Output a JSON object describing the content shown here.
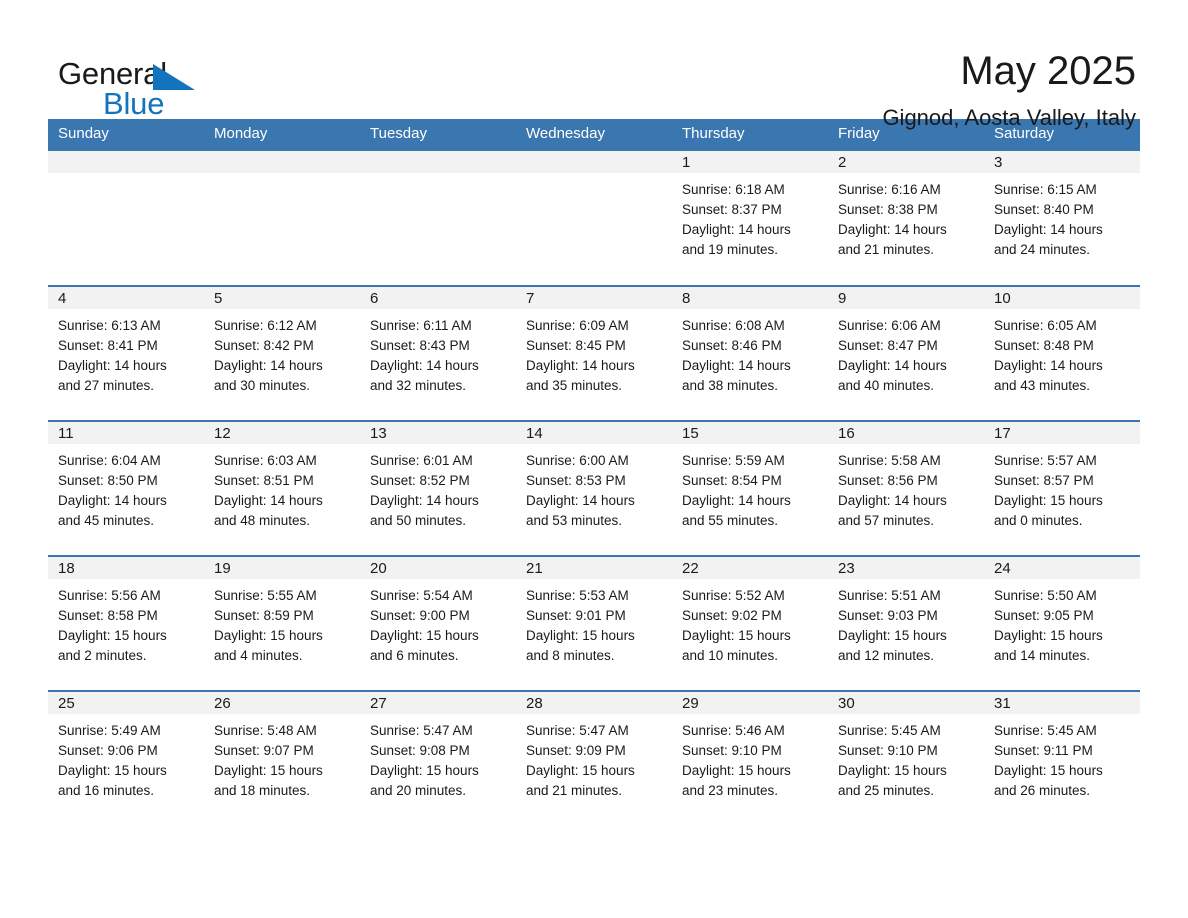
{
  "brand": {
    "name_part1": "General",
    "name_part2": "Blue",
    "accent_color": "#1274bc"
  },
  "header": {
    "title": "May 2025",
    "subtitle": "Gignod, Aosta Valley, Italy"
  },
  "theme": {
    "header_blue": "#3a76b0",
    "day_head_gray": "#f2f2f2",
    "text": "#1a1a1a"
  },
  "calendar": {
    "weekdays": [
      "Sunday",
      "Monday",
      "Tuesday",
      "Wednesday",
      "Thursday",
      "Friday",
      "Saturday"
    ],
    "labels": {
      "sunrise": "Sunrise:",
      "sunset": "Sunset:",
      "daylight": "Daylight:"
    },
    "weeks": [
      [
        {
          "day": "",
          "sunrise": "",
          "sunset": "",
          "daylight_line1": "",
          "daylight_line2": ""
        },
        {
          "day": "",
          "sunrise": "",
          "sunset": "",
          "daylight_line1": "",
          "daylight_line2": ""
        },
        {
          "day": "",
          "sunrise": "",
          "sunset": "",
          "daylight_line1": "",
          "daylight_line2": ""
        },
        {
          "day": "",
          "sunrise": "",
          "sunset": "",
          "daylight_line1": "",
          "daylight_line2": ""
        },
        {
          "day": "1",
          "sunrise": "Sunrise: 6:18 AM",
          "sunset": "Sunset: 8:37 PM",
          "daylight_line1": "Daylight: 14 hours",
          "daylight_line2": "and 19 minutes."
        },
        {
          "day": "2",
          "sunrise": "Sunrise: 6:16 AM",
          "sunset": "Sunset: 8:38 PM",
          "daylight_line1": "Daylight: 14 hours",
          "daylight_line2": "and 21 minutes."
        },
        {
          "day": "3",
          "sunrise": "Sunrise: 6:15 AM",
          "sunset": "Sunset: 8:40 PM",
          "daylight_line1": "Daylight: 14 hours",
          "daylight_line2": "and 24 minutes."
        }
      ],
      [
        {
          "day": "4",
          "sunrise": "Sunrise: 6:13 AM",
          "sunset": "Sunset: 8:41 PM",
          "daylight_line1": "Daylight: 14 hours",
          "daylight_line2": "and 27 minutes."
        },
        {
          "day": "5",
          "sunrise": "Sunrise: 6:12 AM",
          "sunset": "Sunset: 8:42 PM",
          "daylight_line1": "Daylight: 14 hours",
          "daylight_line2": "and 30 minutes."
        },
        {
          "day": "6",
          "sunrise": "Sunrise: 6:11 AM",
          "sunset": "Sunset: 8:43 PM",
          "daylight_line1": "Daylight: 14 hours",
          "daylight_line2": "and 32 minutes."
        },
        {
          "day": "7",
          "sunrise": "Sunrise: 6:09 AM",
          "sunset": "Sunset: 8:45 PM",
          "daylight_line1": "Daylight: 14 hours",
          "daylight_line2": "and 35 minutes."
        },
        {
          "day": "8",
          "sunrise": "Sunrise: 6:08 AM",
          "sunset": "Sunset: 8:46 PM",
          "daylight_line1": "Daylight: 14 hours",
          "daylight_line2": "and 38 minutes."
        },
        {
          "day": "9",
          "sunrise": "Sunrise: 6:06 AM",
          "sunset": "Sunset: 8:47 PM",
          "daylight_line1": "Daylight: 14 hours",
          "daylight_line2": "and 40 minutes."
        },
        {
          "day": "10",
          "sunrise": "Sunrise: 6:05 AM",
          "sunset": "Sunset: 8:48 PM",
          "daylight_line1": "Daylight: 14 hours",
          "daylight_line2": "and 43 minutes."
        }
      ],
      [
        {
          "day": "11",
          "sunrise": "Sunrise: 6:04 AM",
          "sunset": "Sunset: 8:50 PM",
          "daylight_line1": "Daylight: 14 hours",
          "daylight_line2": "and 45 minutes."
        },
        {
          "day": "12",
          "sunrise": "Sunrise: 6:03 AM",
          "sunset": "Sunset: 8:51 PM",
          "daylight_line1": "Daylight: 14 hours",
          "daylight_line2": "and 48 minutes."
        },
        {
          "day": "13",
          "sunrise": "Sunrise: 6:01 AM",
          "sunset": "Sunset: 8:52 PM",
          "daylight_line1": "Daylight: 14 hours",
          "daylight_line2": "and 50 minutes."
        },
        {
          "day": "14",
          "sunrise": "Sunrise: 6:00 AM",
          "sunset": "Sunset: 8:53 PM",
          "daylight_line1": "Daylight: 14 hours",
          "daylight_line2": "and 53 minutes."
        },
        {
          "day": "15",
          "sunrise": "Sunrise: 5:59 AM",
          "sunset": "Sunset: 8:54 PM",
          "daylight_line1": "Daylight: 14 hours",
          "daylight_line2": "and 55 minutes."
        },
        {
          "day": "16",
          "sunrise": "Sunrise: 5:58 AM",
          "sunset": "Sunset: 8:56 PM",
          "daylight_line1": "Daylight: 14 hours",
          "daylight_line2": "and 57 minutes."
        },
        {
          "day": "17",
          "sunrise": "Sunrise: 5:57 AM",
          "sunset": "Sunset: 8:57 PM",
          "daylight_line1": "Daylight: 15 hours",
          "daylight_line2": "and 0 minutes."
        }
      ],
      [
        {
          "day": "18",
          "sunrise": "Sunrise: 5:56 AM",
          "sunset": "Sunset: 8:58 PM",
          "daylight_line1": "Daylight: 15 hours",
          "daylight_line2": "and 2 minutes."
        },
        {
          "day": "19",
          "sunrise": "Sunrise: 5:55 AM",
          "sunset": "Sunset: 8:59 PM",
          "daylight_line1": "Daylight: 15 hours",
          "daylight_line2": "and 4 minutes."
        },
        {
          "day": "20",
          "sunrise": "Sunrise: 5:54 AM",
          "sunset": "Sunset: 9:00 PM",
          "daylight_line1": "Daylight: 15 hours",
          "daylight_line2": "and 6 minutes."
        },
        {
          "day": "21",
          "sunrise": "Sunrise: 5:53 AM",
          "sunset": "Sunset: 9:01 PM",
          "daylight_line1": "Daylight: 15 hours",
          "daylight_line2": "and 8 minutes."
        },
        {
          "day": "22",
          "sunrise": "Sunrise: 5:52 AM",
          "sunset": "Sunset: 9:02 PM",
          "daylight_line1": "Daylight: 15 hours",
          "daylight_line2": "and 10 minutes."
        },
        {
          "day": "23",
          "sunrise": "Sunrise: 5:51 AM",
          "sunset": "Sunset: 9:03 PM",
          "daylight_line1": "Daylight: 15 hours",
          "daylight_line2": "and 12 minutes."
        },
        {
          "day": "24",
          "sunrise": "Sunrise: 5:50 AM",
          "sunset": "Sunset: 9:05 PM",
          "daylight_line1": "Daylight: 15 hours",
          "daylight_line2": "and 14 minutes."
        }
      ],
      [
        {
          "day": "25",
          "sunrise": "Sunrise: 5:49 AM",
          "sunset": "Sunset: 9:06 PM",
          "daylight_line1": "Daylight: 15 hours",
          "daylight_line2": "and 16 minutes."
        },
        {
          "day": "26",
          "sunrise": "Sunrise: 5:48 AM",
          "sunset": "Sunset: 9:07 PM",
          "daylight_line1": "Daylight: 15 hours",
          "daylight_line2": "and 18 minutes."
        },
        {
          "day": "27",
          "sunrise": "Sunrise: 5:47 AM",
          "sunset": "Sunset: 9:08 PM",
          "daylight_line1": "Daylight: 15 hours",
          "daylight_line2": "and 20 minutes."
        },
        {
          "day": "28",
          "sunrise": "Sunrise: 5:47 AM",
          "sunset": "Sunset: 9:09 PM",
          "daylight_line1": "Daylight: 15 hours",
          "daylight_line2": "and 21 minutes."
        },
        {
          "day": "29",
          "sunrise": "Sunrise: 5:46 AM",
          "sunset": "Sunset: 9:10 PM",
          "daylight_line1": "Daylight: 15 hours",
          "daylight_line2": "and 23 minutes."
        },
        {
          "day": "30",
          "sunrise": "Sunrise: 5:45 AM",
          "sunset": "Sunset: 9:10 PM",
          "daylight_line1": "Daylight: 15 hours",
          "daylight_line2": "and 25 minutes."
        },
        {
          "day": "31",
          "sunrise": "Sunrise: 5:45 AM",
          "sunset": "Sunset: 9:11 PM",
          "daylight_line1": "Daylight: 15 hours",
          "daylight_line2": "and 26 minutes."
        }
      ]
    ]
  }
}
